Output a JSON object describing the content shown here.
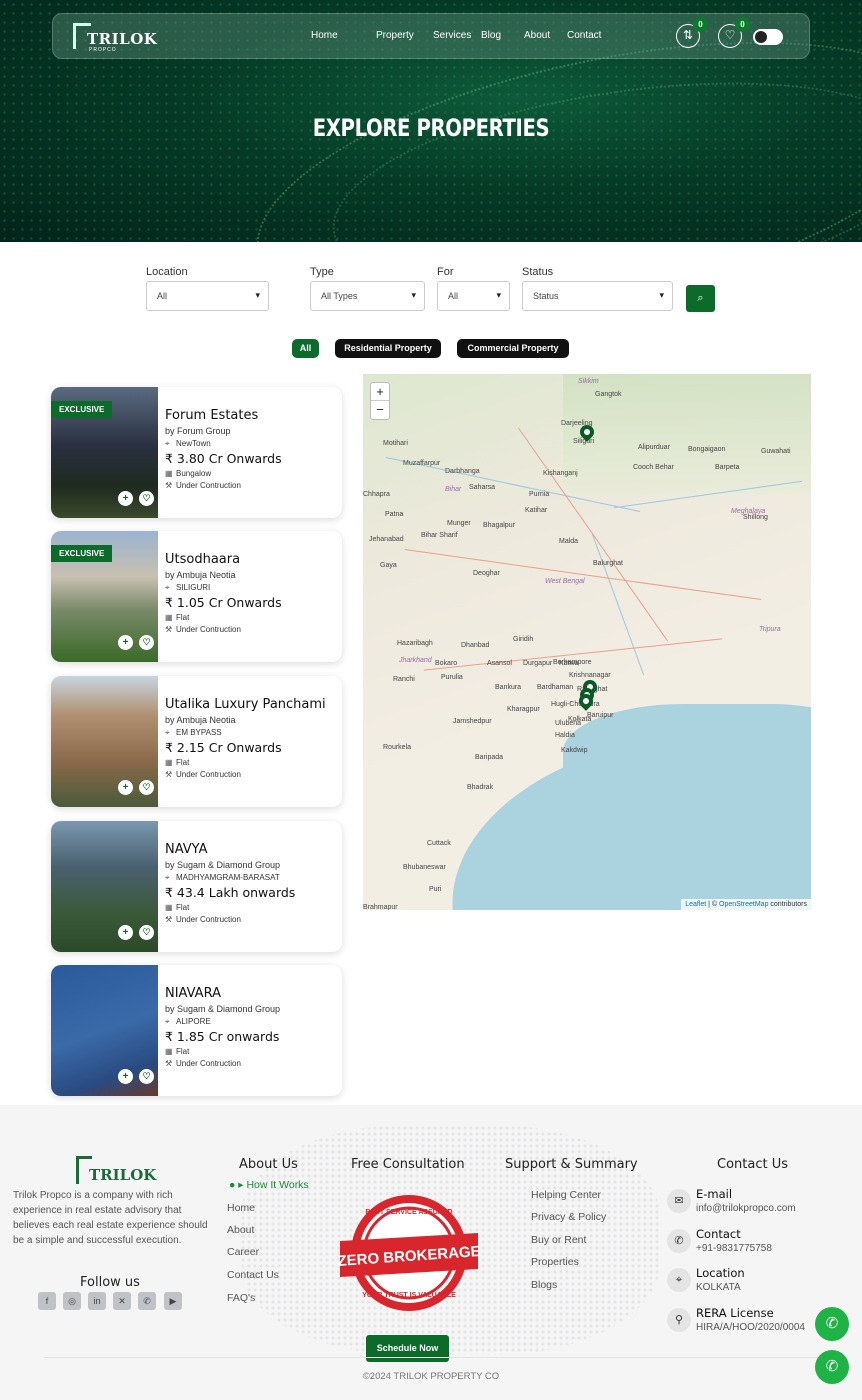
{
  "header": {
    "logo_text": "TRILOK",
    "logo_sub": "PROPCO",
    "nav": [
      "Home",
      "Property",
      "Services",
      "Blog",
      "About",
      "Contact"
    ],
    "compare_count": "0",
    "wishlist_count": "0",
    "hero_title": "EXPLORE PROPERTIES"
  },
  "filters": {
    "location": {
      "label": "Location",
      "value": "All"
    },
    "type": {
      "label": "Type",
      "value": "All Types"
    },
    "for": {
      "label": "For",
      "value": "All"
    },
    "status": {
      "label": "Status",
      "value": "Status"
    }
  },
  "chips": [
    "All",
    "Residential Property",
    "Commercial Property"
  ],
  "listings": [
    {
      "title": "Forum Estates",
      "by": "by Forum Group",
      "location": "NewTown",
      "price": "₹ 3.80 Cr Onwards",
      "type": "Bungalow",
      "status": "Under Contruction",
      "exclusive": "EXCLUSIVE"
    },
    {
      "title": "Utsodhaara",
      "by": "by Ambuja Neotia",
      "location": "SILIGURI",
      "price": "₹ 1.05 Cr Onwards",
      "type": "Flat",
      "status": "Under Contruction",
      "exclusive": "EXCLUSIVE"
    },
    {
      "title": "Utalika Luxury Panchami",
      "by": "by Ambuja Neotia",
      "location": "EM BYPASS",
      "price": "₹ 2.15 Cr Onwards",
      "type": "Flat",
      "status": "Under Contruction",
      "exclusive": ""
    },
    {
      "title": "NAVYA",
      "by": "by Sugam & Diamond Group",
      "location": "MADHYAMGRAM-BARASAT",
      "price": "₹ 43.4 Lakh onwards",
      "type": "Flat",
      "status": "Under Contruction",
      "exclusive": ""
    },
    {
      "title": "NIAVARA",
      "by": "by Sugam & Diamond Group",
      "location": "ALIPORE",
      "price": "₹ 1.85 Cr onwards",
      "type": "Flat",
      "status": "Under Contruction",
      "exclusive": ""
    }
  ],
  "map": {
    "zoom_in": "+",
    "zoom_out": "−",
    "attribution_leaflet": "Leaflet",
    "attribution_sep": " | © ",
    "attribution_osm": "OpenStreetMap",
    "attribution_tail": " contributors",
    "labels": [
      "Sikkim",
      "Gangtok",
      "Darjeeling",
      "Siliguri",
      "Alipurduar",
      "Bongaigaon",
      "Guwahati",
      "Barpeta",
      "Cooch Behar",
      "Meghalaya",
      "Shillong",
      "Kishanganj",
      "Purnia",
      "Katihar",
      "Motihari",
      "Muzaffarpur",
      "Darbhanga",
      "Saharsa",
      "Bihar",
      "Chhapra",
      "Patna",
      "Bhagalpur",
      "Munger",
      "Bihar Sharif",
      "Jehanabad",
      "Malda",
      "Balurghat",
      "Gaya",
      "Deoghar",
      "West Bengal",
      "Hazaribagh",
      "Dhanbad",
      "Giridih",
      "Asansol",
      "Durgapur",
      "Berhampore",
      "Katwa",
      "Jharkhand",
      "Ranchi",
      "Bokaro",
      "Purulia",
      "Bankura",
      "Bardhaman",
      "Ranaghat",
      "Krishnanagar",
      "Hugli-Chuchura",
      "Jamshedpur",
      "Kharagpur",
      "Uluberia",
      "Kolkata",
      "Baruipur",
      "Haldia",
      "Kakdwip",
      "Rourkela",
      "Baripada",
      "Bhadrak",
      "Cuttack",
      "Bhubaneswar",
      "Puri",
      "Tripura",
      "Brahmapur"
    ]
  },
  "footer": {
    "about_text": "Trilok Propco is a company with rich experience in real estate advisory that believes each real estate experience should be a simple and successful execution.",
    "follow_us": "Follow us",
    "about_us": "About Us",
    "how_it_works": "How It Works",
    "about_links": [
      "Home",
      "About",
      "Career",
      "Contact Us",
      "FAQ's"
    ],
    "free_consultation": "Free Consultation",
    "seal_top": "BEST SERVICE ASSURED",
    "seal_main": "ZERO BROKERAGE",
    "seal_bottom": "YOUR TRUST IS VALUABLE",
    "schedule": "Schedule Now",
    "support": "Support & Summary",
    "support_links": [
      "Helping Center",
      "Privacy & Policy",
      "Buy or Rent",
      "Properties",
      "Blogs"
    ],
    "contact_us": "Contact Us",
    "contacts": [
      {
        "title": "E-mail",
        "value": "info@trilokpropco.com"
      },
      {
        "title": "Contact",
        "value": "+91-9831775758"
      },
      {
        "title": "Location",
        "value": "KOLKATA"
      },
      {
        "title": "RERA License",
        "value": "HIRA/A/HOO/2020/0004"
      }
    ],
    "copyright": "©2024 TRILOK PROPERTY CO"
  },
  "colors": {
    "brand_green": "#0c6a2a",
    "whatsapp": "#1fb346"
  }
}
